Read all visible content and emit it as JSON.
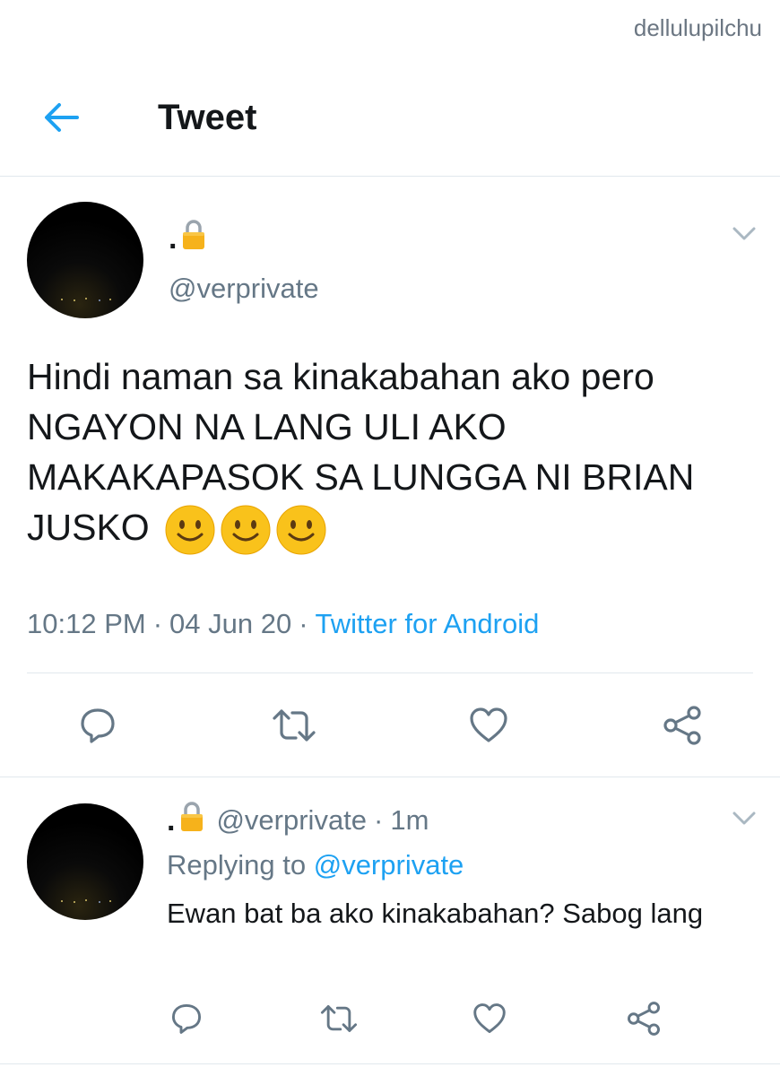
{
  "watermark": "dellulupilchu",
  "header": {
    "title": "Tweet"
  },
  "tweet": {
    "display_name": ".",
    "handle": "@verprivate",
    "text": "Hindi naman sa kinakabahan ako pero NGAYON NA LANG ULI AKO MAKAKAPASOK SA LUNGGA NI BRIAN JUSKO",
    "emojis": [
      "slightly-smiling-face",
      "slightly-smiling-face",
      "slightly-smiling-face"
    ],
    "time": "10:12 PM",
    "date": "04 Jun 20",
    "separator": "·",
    "source": "Twitter for Android"
  },
  "reply": {
    "display_name": ".",
    "handle": "@verprivate",
    "separator": "·",
    "age": "1m",
    "replying_label": "Replying to",
    "replying_to": "@verprivate",
    "text": "Ewan bat ba ako kinakabahan? Sabog lang"
  },
  "icons": {
    "back": "arrow-left-icon",
    "menu": "chevron-down-icon",
    "lock": "lock-icon",
    "reply": "reply-icon",
    "retweet": "retweet-icon",
    "like": "heart-icon",
    "share": "share-icon"
  },
  "colors": {
    "accent": "#1da1f2",
    "muted": "#657786",
    "text": "#14171a",
    "divider": "#e1e8ed",
    "lock": "#f6b21b"
  }
}
